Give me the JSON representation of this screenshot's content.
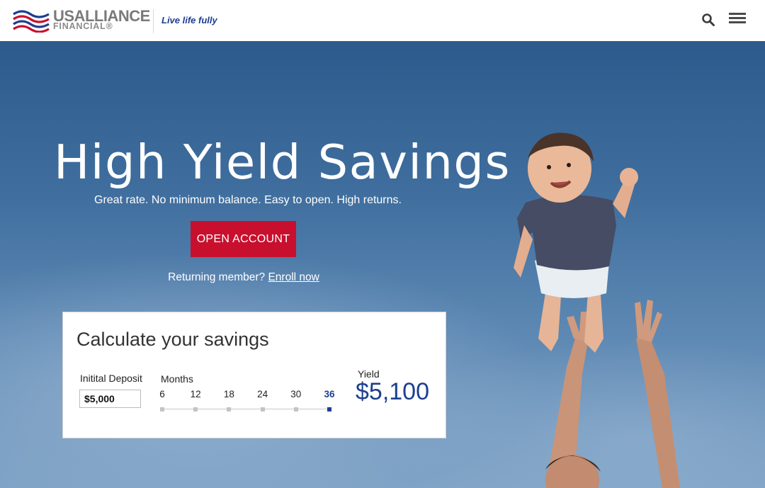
{
  "header": {
    "logo": {
      "brand_top": "USALLIANCE",
      "brand_bottom": "FINANCIAL®"
    },
    "tagline": "Live life fully",
    "icons": {
      "search": "search-icon",
      "menu": "hamburger-menu-icon"
    }
  },
  "hero": {
    "title": "High Yield Savings",
    "subtitle": "Great rate. No minimum balance. Easy to open. High returns.",
    "cta_label": "OPEN ACCOUNT",
    "returning_text": "Returning member?",
    "enroll_link": "Enroll now"
  },
  "calculator": {
    "title": "Calculate your savings",
    "deposit_label": "Initital Deposit",
    "deposit_value": "$5,000",
    "months_label": "Months",
    "months": [
      "6",
      "12",
      "18",
      "24",
      "30",
      "36"
    ],
    "selected_month": "36",
    "yield_label": "Yield",
    "yield_value": "$5,100"
  },
  "colors": {
    "brand_red": "#c8102e",
    "brand_blue": "#1d3f8f",
    "header_bg": "#ffffff"
  }
}
